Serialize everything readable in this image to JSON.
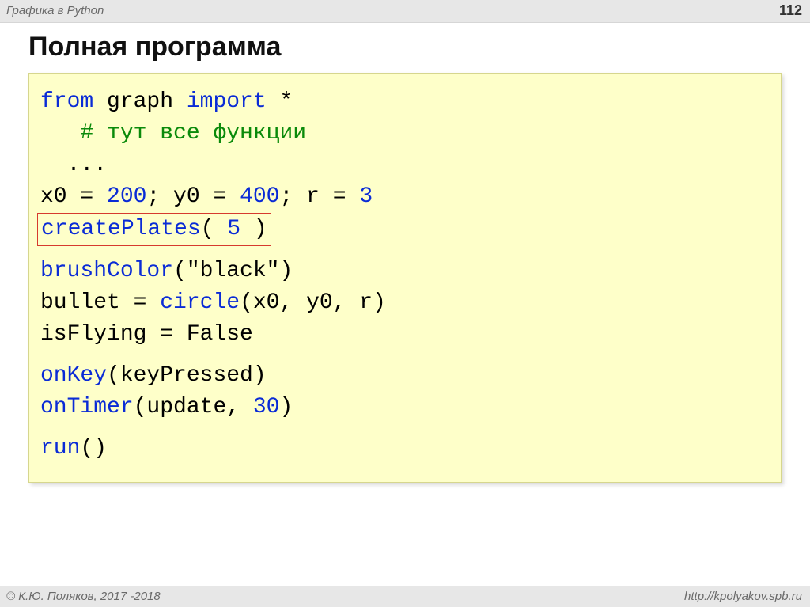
{
  "header": {
    "breadcrumb": "Графика в Python",
    "page_number": "112"
  },
  "title": "Полная программа",
  "code": {
    "l1_from": "from",
    "l1_graph": " graph ",
    "l1_import": "import",
    "l1_star": " *",
    "l2_indent": "   ",
    "l2_comment": "# тут все функции",
    "l3": "  ...",
    "l4_a": "x0 = ",
    "l4_n1": "200",
    "l4_b": "; y0 = ",
    "l4_n2": "400",
    "l4_c": "; r = ",
    "l4_n3": "3",
    "l5_fn": "createPlates",
    "l5_open": "( ",
    "l5_arg": "5",
    "l5_close": " )",
    "l6_fn": "brushColor",
    "l6_open": "(",
    "l6_str": "\"black\"",
    "l6_close": ")",
    "l7_a": "bullet = ",
    "l7_fn": "circle",
    "l7_args": "(x0, y0, r)",
    "l8": "isFlying = False",
    "l9_fn": "onKey",
    "l9_args": "(keyPressed)",
    "l10_fn": "onTimer",
    "l10_open": "(update, ",
    "l10_n": "30",
    "l10_close": ")",
    "l11_fn": "run",
    "l11_args": "()"
  },
  "footer": {
    "copyright": "© К.Ю. Поляков, 2017 -2018",
    "url": "http://kpolyakov.spb.ru"
  }
}
